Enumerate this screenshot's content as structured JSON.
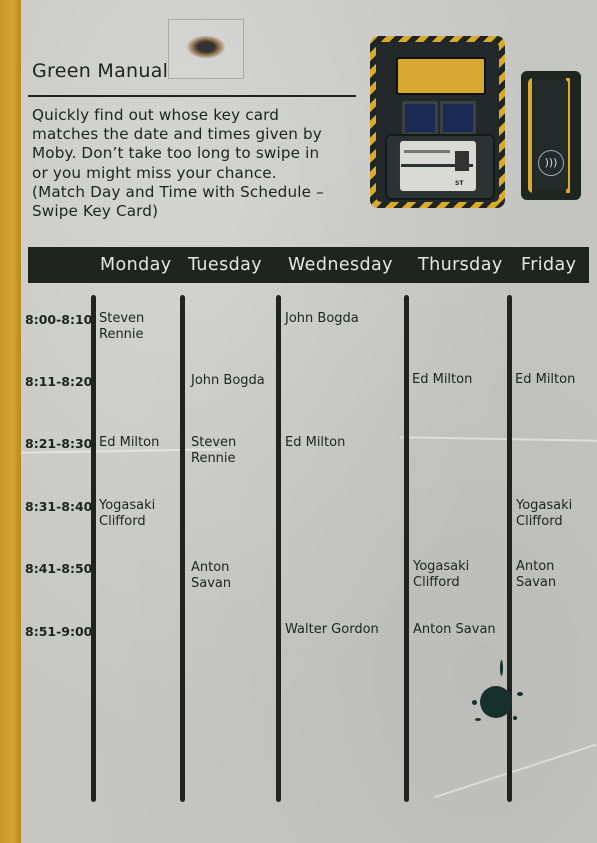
{
  "manual": {
    "title": "Green Manual",
    "instructions": [
      "Quickly find out whose key card",
      "matches the date and times given by",
      "Moby. Don’t take too long to swipe in",
      "or you might miss your chance.",
      "(Match Day and Time with Schedule –",
      "Swipe Key Card)"
    ]
  },
  "schedule": {
    "days": [
      "Monday",
      "Tuesday",
      "Wednesday",
      "Thursday",
      "Friday"
    ],
    "times": [
      "8:00-8:10",
      "8:11-8:20",
      "8:21-8:30",
      "8:31-8:40",
      "8:41-8:50",
      "8:51-9:00"
    ],
    "cells": {
      "r0_monday": "Steven Rennie",
      "r0_wednesday": "John Bogda",
      "r1_tuesday": "John Bogda",
      "r1_thursday": "Ed Milton",
      "r1_friday": "Ed Milton",
      "r2_monday": "Ed Milton",
      "r2_tuesday": "Steven Rennie",
      "r2_wednesday": "Ed Milton",
      "r3_monday": "Yogasaki Clifford",
      "r3_friday": "Yogasaki Clifford",
      "r4_tuesday": "Anton Savan",
      "r4_thursday": "Yogasaki Clifford",
      "r4_friday": "Anton Savan",
      "r5_wednesday": "Walter Gordon",
      "r5_thursday": "Anton Savan"
    }
  },
  "device": {
    "card_code": "ST"
  },
  "colors": {
    "paper": "#c6c6c4",
    "spine": "#d2a334",
    "ink": "#1f2320",
    "header_text": "#e7e7e2",
    "accent_yellow": "#d9aa2b",
    "button_blue": "#1a2a55"
  },
  "icons": {
    "reader": "contactless-icon",
    "stain": "ink-splat-icon"
  }
}
